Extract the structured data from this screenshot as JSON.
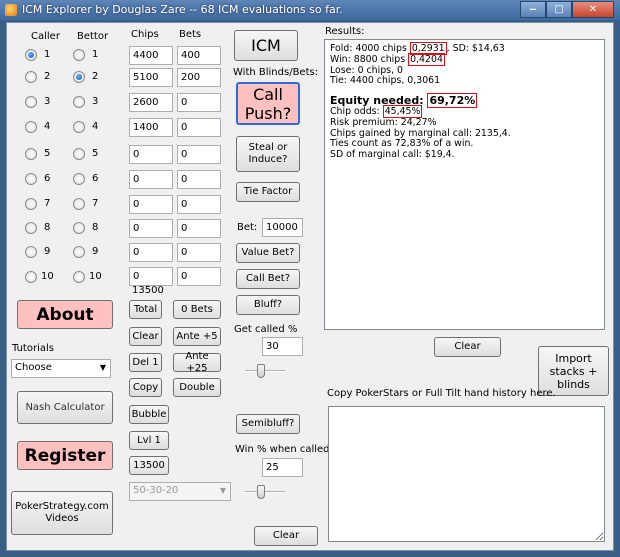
{
  "window": {
    "title": "ICM Explorer by Douglas Zare -- 68 ICM evaluations so far.",
    "minimize": "‒",
    "maximize": "□",
    "close": "✕"
  },
  "table": {
    "header_caller": "Caller",
    "header_bettor": "Bettor",
    "header_chips": "Chips",
    "header_bets": "Bets",
    "players": [
      {
        "num": "1",
        "chips": "4400",
        "bets": "400"
      },
      {
        "num": "2",
        "chips": "5100",
        "bets": "200"
      },
      {
        "num": "3",
        "chips": "2600",
        "bets": "0"
      },
      {
        "num": "4",
        "chips": "1400",
        "bets": "0"
      },
      {
        "num": "5",
        "chips": "0",
        "bets": "0"
      },
      {
        "num": "6",
        "chips": "0",
        "bets": "0"
      },
      {
        "num": "7",
        "chips": "0",
        "bets": "0"
      },
      {
        "num": "8",
        "chips": "0",
        "bets": "0"
      },
      {
        "num": "9",
        "chips": "0",
        "bets": "0"
      },
      {
        "num": "10",
        "chips": "0",
        "bets": "0"
      }
    ],
    "selected_caller": "1",
    "selected_bettor": "2",
    "total_chips": "13500"
  },
  "left": {
    "about": "About",
    "tutorials_label": "Tutorials",
    "tutorials_value": "Choose",
    "nash_calculator": "Nash Calculator",
    "register": "Register",
    "pokerstrategy_line1": "PokerStrategy.com",
    "pokerstrategy_line2": "Videos"
  },
  "chip_buttons": {
    "total": "Total",
    "zero_bets": "0 Bets",
    "clear": "Clear",
    "ante5": "Ante +5",
    "del1": "Del 1",
    "ante25": "Ante +25",
    "copy": "Copy",
    "double": "Double",
    "bubble": "Bubble",
    "lvl1": "Lvl 1",
    "stack_13500": "13500",
    "payout": "50-30-20"
  },
  "middle": {
    "icm": "ICM",
    "with_blinds_label": "With Blinds/Bets:",
    "call_line1": "Call",
    "call_line2": "Push?",
    "steal_line1": "Steal or",
    "steal_line2": "Induce?",
    "tie_factor": "Tie Factor",
    "bet_label": "Bet:",
    "bet_value": "10000",
    "value_bet": "Value Bet?",
    "call_bet": "Call Bet?",
    "bluff": "Bluff?",
    "get_called_label": "Get called %",
    "get_called_value": "30",
    "semibluff": "Semibluff?",
    "win_when_called_label": "Win % when called",
    "win_when_called_value": "25",
    "clear": "Clear"
  },
  "results": {
    "title": "Results:",
    "fold_a": "Fold: 4000 chips ",
    "fold_hl": "0,2931",
    "fold_b": ", SD: $14,63",
    "win_a": "Win: 8800 chips ",
    "win_hl": "0,4204",
    "lose": "Lose: 0 chips, 0",
    "tie": "Tie: 4400 chips, 0,3061",
    "equity_a": "Equity needed: ",
    "equity_hl": "69,72%",
    "odds_a": "Chip odds: ",
    "odds_hl": "45,45%",
    "risk": "Risk premium: 24,27%",
    "chips_gained": "Chips gained by marginal call: 2135,4.",
    "ties": "Ties count as 72,83% of a win.",
    "sd": "SD of marginal call: $19,4."
  },
  "right": {
    "clear": "Clear",
    "import_line1": "Import",
    "import_line2": "stacks +",
    "import_line3": "blinds",
    "history_label": "Copy PokerStars or Full Tilt hand history here."
  }
}
